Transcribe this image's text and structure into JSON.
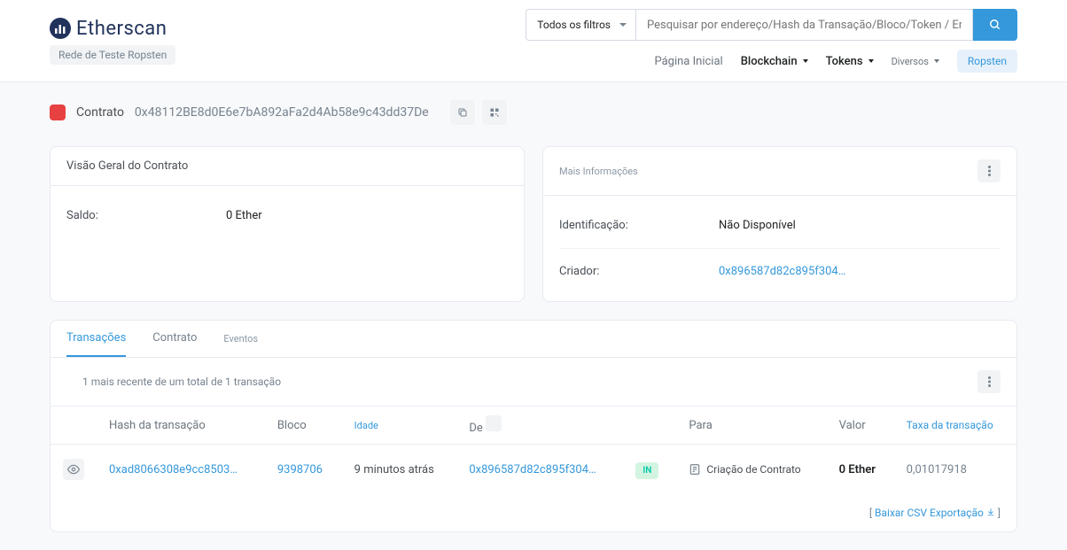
{
  "header": {
    "logo_text": "Etherscan",
    "network": "Rede de Teste Ropsten",
    "filter_label": "Todos os filtros",
    "search_placeholder": "Pesquisar por endereço/Hash da Transação/Bloco/Token / Ens",
    "nav": {
      "home": "Página Inicial",
      "blockchain": "Blockchain",
      "tokens": "Tokens",
      "misc": "Diversos",
      "ropsten": "Ropsten"
    }
  },
  "contract": {
    "label": "Contrato",
    "address": "0x48112BE8d0E6e7bA892aFa2d4Ab58e9c43dd37De"
  },
  "overview": {
    "title": "Visão Geral do Contrato",
    "balance_label": "Saldo:",
    "balance_value": "0 Ether"
  },
  "moreinfo": {
    "title": "Mais Informações",
    "id_label": "Identificação:",
    "id_value": "Não Disponível",
    "creator_label": "Criador:",
    "creator_value": "0x896587d82c895f304…"
  },
  "tabs": {
    "transactions": "Transações",
    "contract": "Contrato",
    "events": "Eventos"
  },
  "table": {
    "summary": "1 mais recente de um total de 1 transação",
    "headers": {
      "txhash": "Hash da transação",
      "block": "Bloco",
      "age": "Idade",
      "from": "De",
      "to": "Para",
      "value": "Valor",
      "fee": "Taxa da transação"
    },
    "rows": [
      {
        "txhash": "0xad8066308e9cc8503…",
        "block": "9398706",
        "age": "9 minutos atrás",
        "from": "0x896587d82c895f304…",
        "direction": "IN",
        "to": "Criação de Contrato",
        "value": "0 Ether",
        "fee": "0,01017918"
      }
    ],
    "footer_prefix": "[ ",
    "footer_link": "Baixar CSV Exportação",
    "footer_suffix": " ]"
  }
}
